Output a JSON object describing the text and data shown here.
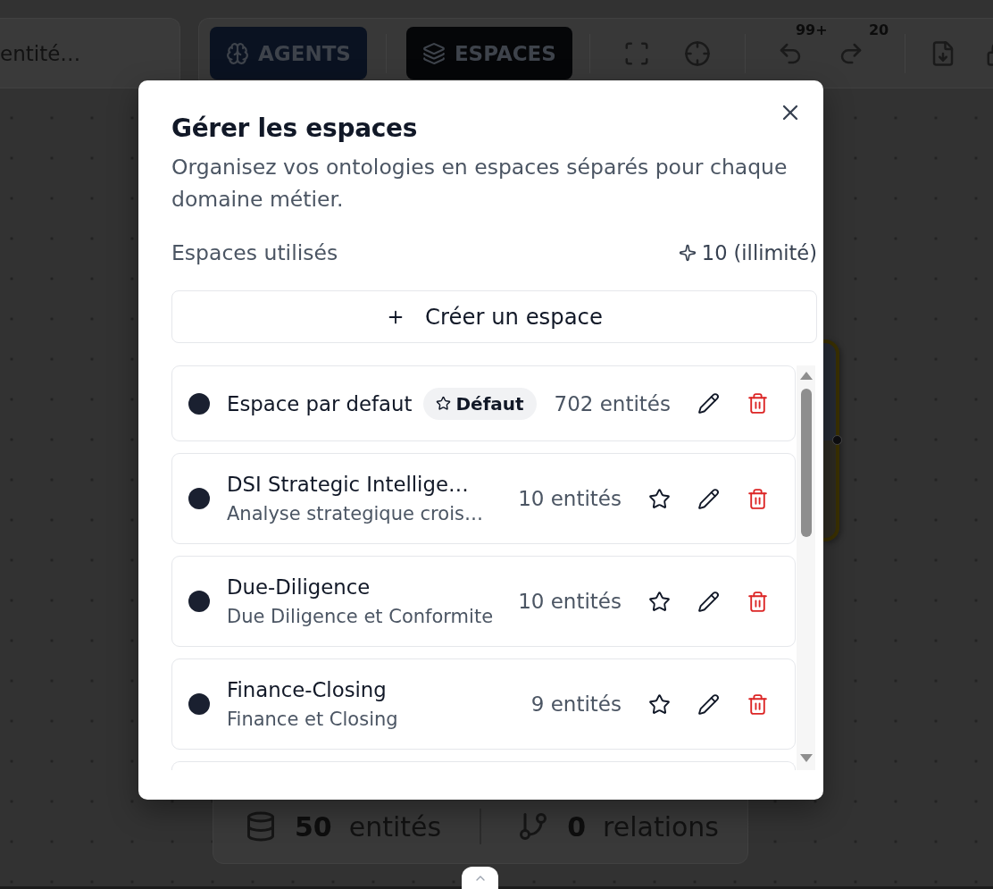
{
  "search": {
    "placeholder": "entité…"
  },
  "toolbar": {
    "modes": [
      {
        "kind": "agents",
        "label": "AGENTS",
        "selected": false
      },
      {
        "kind": "spaces",
        "label": "ESPACES",
        "selected": true
      }
    ],
    "undo_count": "99+",
    "redo_count": "20"
  },
  "dialog": {
    "title": "Gérer les espaces",
    "description": "Organisez vos ontologies en espaces séparés pour chaque domaine métier.",
    "usage_label": "Espaces utilisés",
    "usage_value": "10 (illimité)",
    "create_label": "Créer un espace",
    "spaces": [
      {
        "name": "Espace par defaut",
        "default": true,
        "badge": "Défaut",
        "count": "702 entités"
      },
      {
        "name": "DSI Strategic Intellige…",
        "description": "Analyse strategique crois…",
        "default": false,
        "count": "10 entités"
      },
      {
        "name": "Due-Diligence",
        "description": "Due Diligence et Conformite",
        "default": false,
        "count": "10 entités"
      },
      {
        "name": "Finance-Closing",
        "description": "Finance et Closing",
        "default": false,
        "count": "9 entités"
      }
    ]
  },
  "stats": [
    {
      "kind": "entities",
      "value": "50",
      "label": "entités"
    },
    {
      "kind": "relations",
      "value": "0",
      "label": "relations"
    }
  ]
}
